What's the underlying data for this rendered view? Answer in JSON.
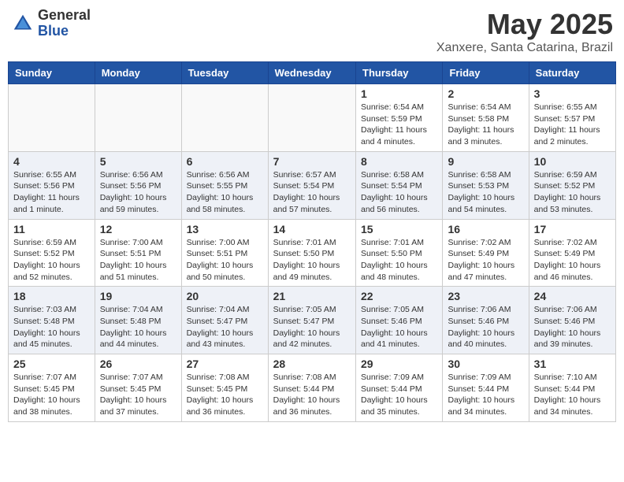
{
  "logo": {
    "general": "General",
    "blue": "Blue"
  },
  "title": {
    "month": "May 2025",
    "location": "Xanxere, Santa Catarina, Brazil"
  },
  "weekdays": [
    "Sunday",
    "Monday",
    "Tuesday",
    "Wednesday",
    "Thursday",
    "Friday",
    "Saturday"
  ],
  "weeks": [
    [
      {
        "day": "",
        "info": ""
      },
      {
        "day": "",
        "info": ""
      },
      {
        "day": "",
        "info": ""
      },
      {
        "day": "",
        "info": ""
      },
      {
        "day": "1",
        "info": "Sunrise: 6:54 AM\nSunset: 5:59 PM\nDaylight: 11 hours\nand 4 minutes."
      },
      {
        "day": "2",
        "info": "Sunrise: 6:54 AM\nSunset: 5:58 PM\nDaylight: 11 hours\nand 3 minutes."
      },
      {
        "day": "3",
        "info": "Sunrise: 6:55 AM\nSunset: 5:57 PM\nDaylight: 11 hours\nand 2 minutes."
      }
    ],
    [
      {
        "day": "4",
        "info": "Sunrise: 6:55 AM\nSunset: 5:56 PM\nDaylight: 11 hours\nand 1 minute."
      },
      {
        "day": "5",
        "info": "Sunrise: 6:56 AM\nSunset: 5:56 PM\nDaylight: 10 hours\nand 59 minutes."
      },
      {
        "day": "6",
        "info": "Sunrise: 6:56 AM\nSunset: 5:55 PM\nDaylight: 10 hours\nand 58 minutes."
      },
      {
        "day": "7",
        "info": "Sunrise: 6:57 AM\nSunset: 5:54 PM\nDaylight: 10 hours\nand 57 minutes."
      },
      {
        "day": "8",
        "info": "Sunrise: 6:58 AM\nSunset: 5:54 PM\nDaylight: 10 hours\nand 56 minutes."
      },
      {
        "day": "9",
        "info": "Sunrise: 6:58 AM\nSunset: 5:53 PM\nDaylight: 10 hours\nand 54 minutes."
      },
      {
        "day": "10",
        "info": "Sunrise: 6:59 AM\nSunset: 5:52 PM\nDaylight: 10 hours\nand 53 minutes."
      }
    ],
    [
      {
        "day": "11",
        "info": "Sunrise: 6:59 AM\nSunset: 5:52 PM\nDaylight: 10 hours\nand 52 minutes."
      },
      {
        "day": "12",
        "info": "Sunrise: 7:00 AM\nSunset: 5:51 PM\nDaylight: 10 hours\nand 51 minutes."
      },
      {
        "day": "13",
        "info": "Sunrise: 7:00 AM\nSunset: 5:51 PM\nDaylight: 10 hours\nand 50 minutes."
      },
      {
        "day": "14",
        "info": "Sunrise: 7:01 AM\nSunset: 5:50 PM\nDaylight: 10 hours\nand 49 minutes."
      },
      {
        "day": "15",
        "info": "Sunrise: 7:01 AM\nSunset: 5:50 PM\nDaylight: 10 hours\nand 48 minutes."
      },
      {
        "day": "16",
        "info": "Sunrise: 7:02 AM\nSunset: 5:49 PM\nDaylight: 10 hours\nand 47 minutes."
      },
      {
        "day": "17",
        "info": "Sunrise: 7:02 AM\nSunset: 5:49 PM\nDaylight: 10 hours\nand 46 minutes."
      }
    ],
    [
      {
        "day": "18",
        "info": "Sunrise: 7:03 AM\nSunset: 5:48 PM\nDaylight: 10 hours\nand 45 minutes."
      },
      {
        "day": "19",
        "info": "Sunrise: 7:04 AM\nSunset: 5:48 PM\nDaylight: 10 hours\nand 44 minutes."
      },
      {
        "day": "20",
        "info": "Sunrise: 7:04 AM\nSunset: 5:47 PM\nDaylight: 10 hours\nand 43 minutes."
      },
      {
        "day": "21",
        "info": "Sunrise: 7:05 AM\nSunset: 5:47 PM\nDaylight: 10 hours\nand 42 minutes."
      },
      {
        "day": "22",
        "info": "Sunrise: 7:05 AM\nSunset: 5:46 PM\nDaylight: 10 hours\nand 41 minutes."
      },
      {
        "day": "23",
        "info": "Sunrise: 7:06 AM\nSunset: 5:46 PM\nDaylight: 10 hours\nand 40 minutes."
      },
      {
        "day": "24",
        "info": "Sunrise: 7:06 AM\nSunset: 5:46 PM\nDaylight: 10 hours\nand 39 minutes."
      }
    ],
    [
      {
        "day": "25",
        "info": "Sunrise: 7:07 AM\nSunset: 5:45 PM\nDaylight: 10 hours\nand 38 minutes."
      },
      {
        "day": "26",
        "info": "Sunrise: 7:07 AM\nSunset: 5:45 PM\nDaylight: 10 hours\nand 37 minutes."
      },
      {
        "day": "27",
        "info": "Sunrise: 7:08 AM\nSunset: 5:45 PM\nDaylight: 10 hours\nand 36 minutes."
      },
      {
        "day": "28",
        "info": "Sunrise: 7:08 AM\nSunset: 5:44 PM\nDaylight: 10 hours\nand 36 minutes."
      },
      {
        "day": "29",
        "info": "Sunrise: 7:09 AM\nSunset: 5:44 PM\nDaylight: 10 hours\nand 35 minutes."
      },
      {
        "day": "30",
        "info": "Sunrise: 7:09 AM\nSunset: 5:44 PM\nDaylight: 10 hours\nand 34 minutes."
      },
      {
        "day": "31",
        "info": "Sunrise: 7:10 AM\nSunset: 5:44 PM\nDaylight: 10 hours\nand 34 minutes."
      }
    ]
  ]
}
